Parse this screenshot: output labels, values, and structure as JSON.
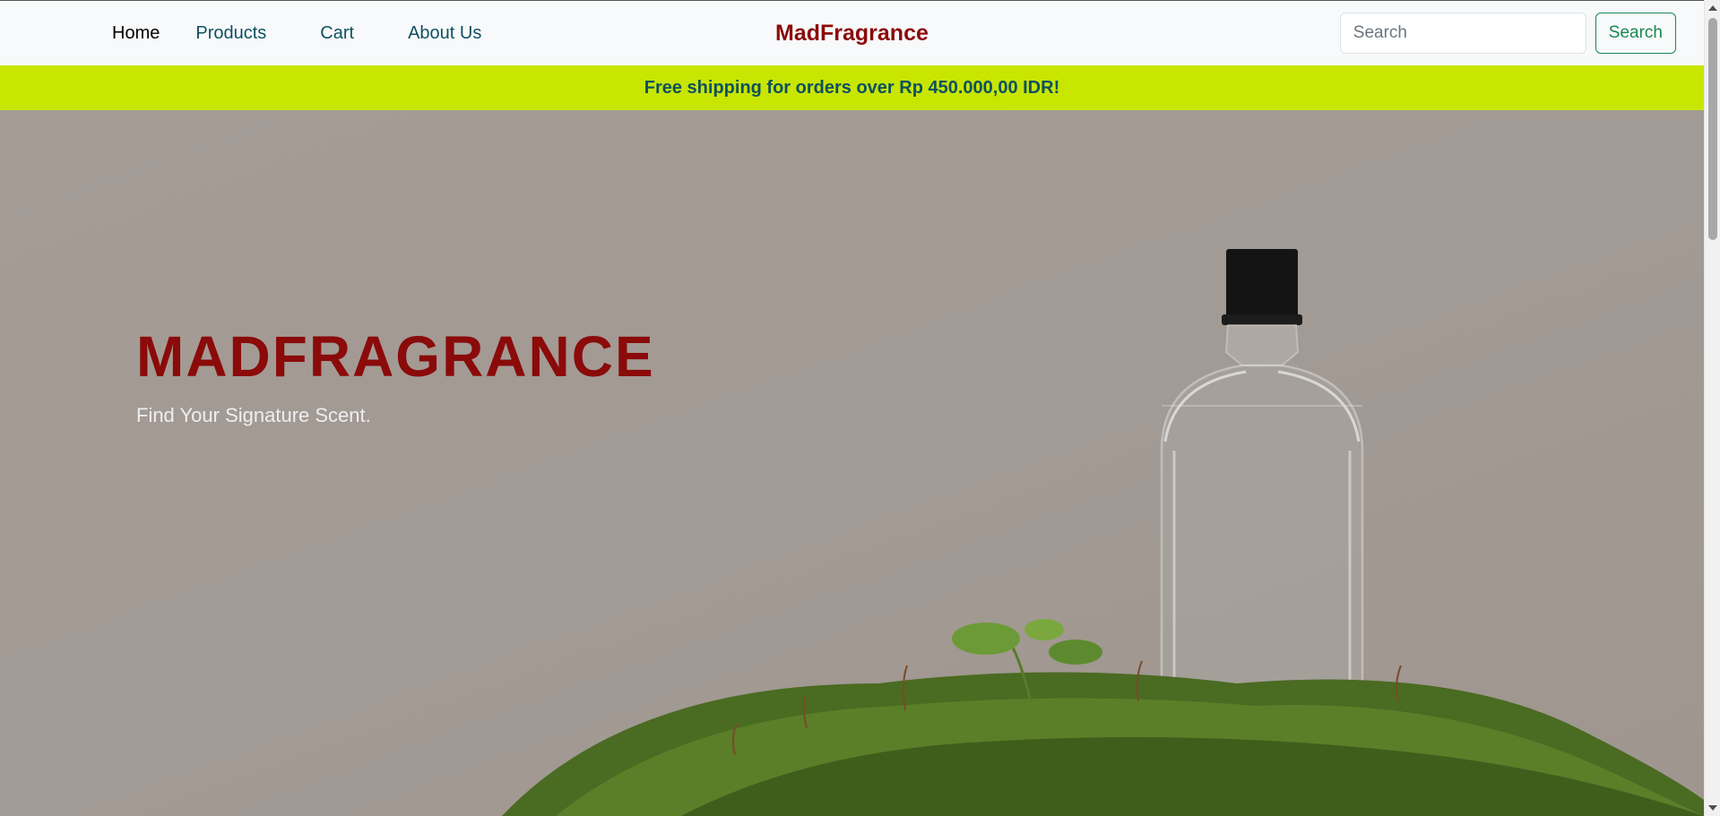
{
  "nav": {
    "links": [
      {
        "label": "Home",
        "active": true
      },
      {
        "label": "Products",
        "active": false
      },
      {
        "label": "Cart",
        "active": false
      },
      {
        "label": "About Us",
        "active": false
      }
    ],
    "brand": "MadFragrance",
    "search": {
      "placeholder": "Search",
      "value": "",
      "button_label": "Search"
    }
  },
  "promo": {
    "text": "Free shipping for orders over Rp 450.000,00 IDR!"
  },
  "hero": {
    "title": "MADFRAGRANCE",
    "subtitle": "Find Your Signature Scent.",
    "image_description": "perfume-bottle-on-moss"
  },
  "colors": {
    "brand": "#8b0a0a",
    "nav_link": "#0d5160",
    "promo_bg": "#c8e600",
    "search_button": "#198754",
    "hero_bg": "#a39a94"
  }
}
